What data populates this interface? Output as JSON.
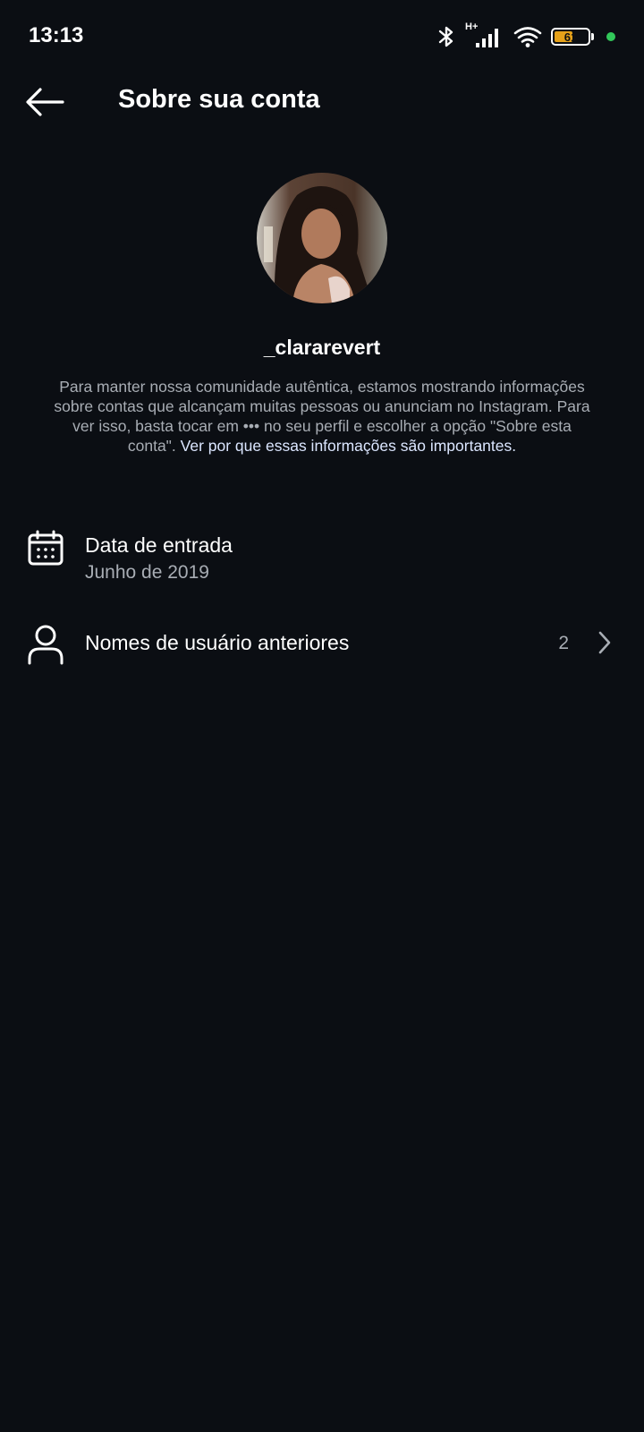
{
  "status_bar": {
    "time": "13:13",
    "network_label": "H+",
    "battery_level": 61,
    "battery_text": "61",
    "battery_color": "#e5a11a",
    "dot_color": "#32c85a",
    "icons": [
      "bluetooth-icon",
      "signal-icon",
      "wifi-icon",
      "battery-icon"
    ]
  },
  "header": {
    "title": "Sobre sua conta",
    "back_icon": "arrow-left-icon"
  },
  "profile": {
    "username": "_clararevert",
    "description_text": "Para manter nossa comunidade autêntica, estamos mostrando informações sobre contas que alcançam muitas pessoas ou anunciam no Instagram. Para ver isso, basta tocar em ••• no seu perfil e escolher a opção \"Sobre esta conta\".",
    "description_link": "Ver por que essas informações são importantes."
  },
  "rows": {
    "join_date": {
      "icon": "calendar-icon",
      "title": "Data de entrada",
      "value": "Junho de 2019"
    },
    "former_usernames": {
      "icon": "person-icon",
      "title": "Nomes de usuário anteriores",
      "count": "2",
      "chevron": "chevron-right-icon"
    }
  },
  "colors": {
    "background": "#0b0e13",
    "secondary_text": "#a8adb4",
    "link": "#dbe6ff"
  }
}
